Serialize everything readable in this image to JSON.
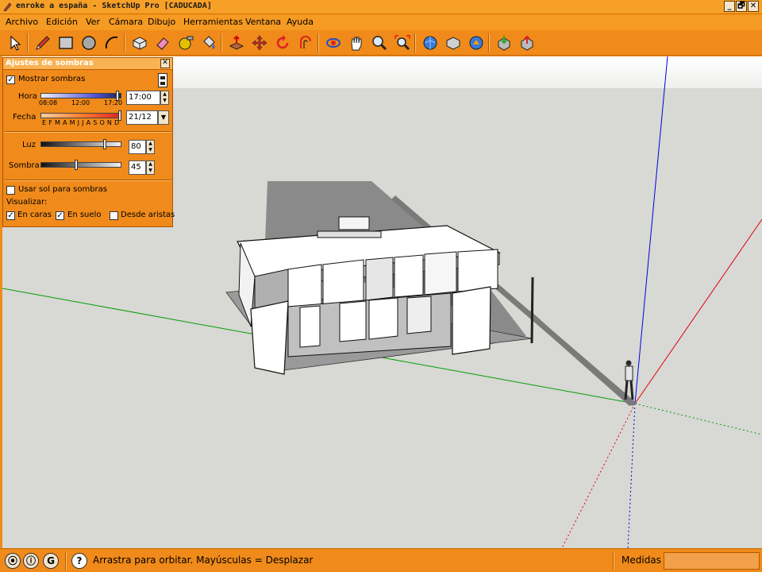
{
  "window": {
    "title": "enroke a españa - SketchUp Pro [CADUCADA]",
    "controls": [
      "_",
      "🗗",
      "✕"
    ]
  },
  "menu": [
    "Archivo",
    "Edición",
    "Ver",
    "Cámara",
    "Dibujo",
    "Herramientas",
    "Ventana",
    "Ayuda"
  ],
  "toolbar": {
    "tools": [
      {
        "name": "select-icon"
      },
      {
        "name": "pencil-icon"
      },
      {
        "name": "rectangle-icon"
      },
      {
        "name": "circle-icon"
      },
      {
        "name": "arc-icon"
      },
      {
        "name": "make-component-icon"
      },
      {
        "name": "eraser-icon"
      },
      {
        "name": "tape-measure-icon"
      },
      {
        "name": "paint-bucket-icon"
      },
      {
        "name": "push-pull-icon"
      },
      {
        "name": "move-icon"
      },
      {
        "name": "rotate-icon"
      },
      {
        "name": "offset-icon"
      },
      {
        "name": "orbit-icon"
      },
      {
        "name": "pan-icon"
      },
      {
        "name": "zoom-icon"
      },
      {
        "name": "zoom-extents-icon"
      },
      {
        "name": "get-models-icon"
      },
      {
        "name": "share-model-icon"
      },
      {
        "name": "google-earth-icon"
      },
      {
        "name": "get-components-icon"
      },
      {
        "name": "share-component-icon"
      }
    ]
  },
  "shadow_panel": {
    "title": "Ajustes de sombras",
    "show_shadows_label": "Mostrar sombras",
    "show_shadows_checked": true,
    "time_label": "Hora",
    "time_ticks": [
      "08:08",
      "12:00",
      "17:20"
    ],
    "time_value": "17:00",
    "time_slider_fraction": 0.93,
    "date_label": "Fecha",
    "date_ticks": "E F M A M J J A S O N D",
    "date_value": "21/12",
    "date_slider_fraction": 0.97,
    "light_label": "Luz",
    "light_value": "80",
    "dark_label": "Sombra",
    "dark_value": "45",
    "use_sun_label": "Usar sol para sombras",
    "use_sun_checked": false,
    "display_label": "Visualizar:",
    "on_faces_label": "En caras",
    "on_faces_checked": true,
    "on_ground_label": "En suelo",
    "on_ground_checked": true,
    "from_edges_label": "Desde aristas",
    "from_edges_checked": false
  },
  "status": {
    "text": "Arrastra para orbitar. Mayúsculas = Desplazar",
    "measurements_label": "Medidas",
    "measurements_value": "",
    "icons": [
      "geo-location-icon",
      "credits-icon",
      "sign-in-icon",
      "help-icon"
    ]
  },
  "colors": {
    "chrome": "#f08a1a",
    "viewport_ground": "#d8d8d5",
    "axis_green": "#00a000",
    "axis_red": "#e00000",
    "axis_blue": "#0000e0"
  }
}
